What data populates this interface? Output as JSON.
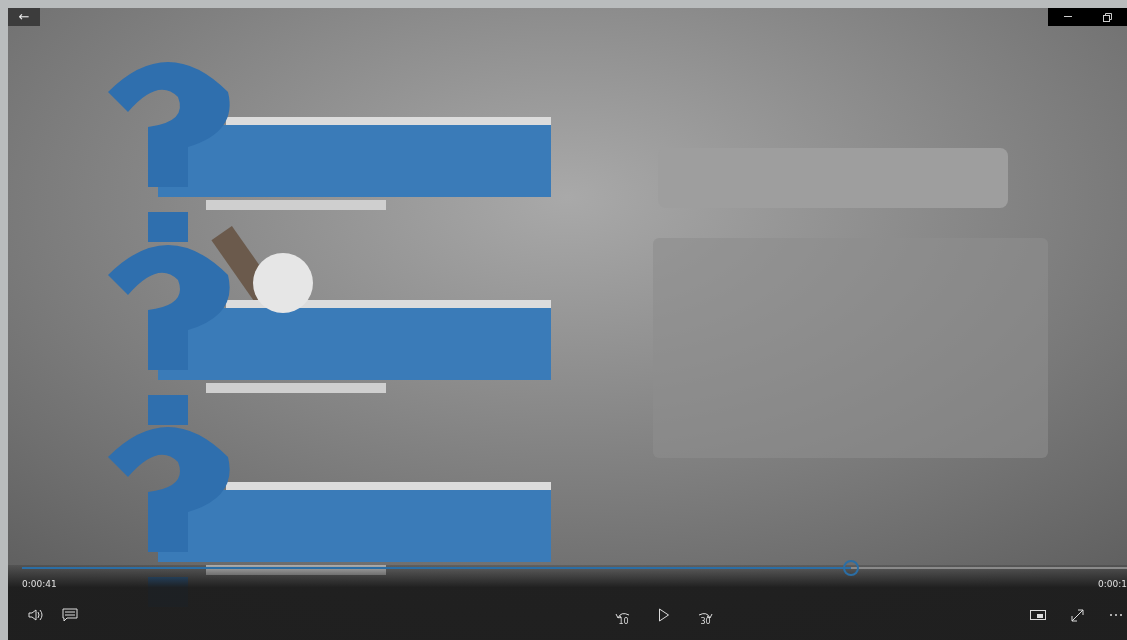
{
  "title_bar": {
    "back": "←"
  },
  "player": {
    "elapsed": "0:00:41",
    "remaining": "0:00:1",
    "progress": {
      "level": 0.75
    },
    "skip_back": "10",
    "skip_forward": "30",
    "playing": false
  }
}
